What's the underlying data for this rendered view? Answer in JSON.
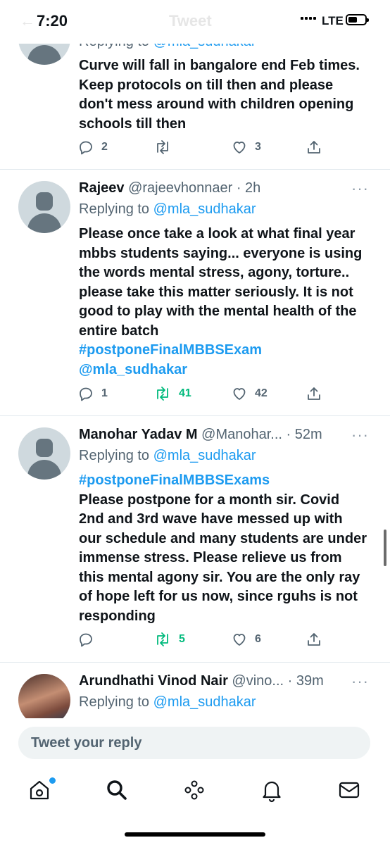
{
  "status_bar": {
    "time": "7:20",
    "network": "LTE",
    "ghost_title": "Tweet",
    "ghost_back": "←"
  },
  "tweets": [
    {
      "replying_prefix": "Replying to",
      "replying_to": "@mla_sudhakar",
      "body": "Curve will fall in bangalore end Feb times. Keep protocols on till then and please don't mess around with children opening schools till then",
      "replies": "2",
      "retweets": "",
      "likes": "3"
    },
    {
      "name": "Rajeev",
      "handle": "@rajeevhonnaer",
      "time": "· 2h",
      "replying_prefix": "Replying to",
      "replying_to": "@mla_sudhakar",
      "body": "Please once take a look at what final year mbbs students saying... everyone is using the words mental stress, agony, torture.. please take this matter seriously. It is not good to play with the mental health of the entire batch",
      "hashtag": "#postponeFinalMBBSExam",
      "mention": "@mla_sudhakar",
      "replies": "1",
      "retweets": "41",
      "likes": "42"
    },
    {
      "name": "Manohar Yadav M",
      "handle": "@Manohar...",
      "time": "· 52m",
      "replying_prefix": "Replying to",
      "replying_to": "@mla_sudhakar",
      "hashtag": "#postponeFinalMBBSExams",
      "body": "Please postpone for a month sir. Covid 2nd and 3rd wave have messed up with our schedule and many students are under immense stress. Please relieve us from this mental agony sir. You are the only ray of hope left for us now, since rguhs is not responding",
      "replies": "",
      "retweets": "5",
      "likes": "6"
    },
    {
      "name": "Arundhathi Vinod Nair",
      "handle": "@vino...",
      "time": "· 39m",
      "replying_prefix": "Replying to",
      "replying_to": "@mla_sudhakar"
    }
  ],
  "more_icon": "···",
  "reply_placeholder": "Tweet your reply",
  "tabs": [
    "home-icon",
    "search-icon",
    "spaces-icon",
    "notifications-icon",
    "messages-icon"
  ],
  "colors": {
    "accent": "#1d9bf0",
    "retweet_green": "#00ba7c",
    "muted": "#536471"
  }
}
